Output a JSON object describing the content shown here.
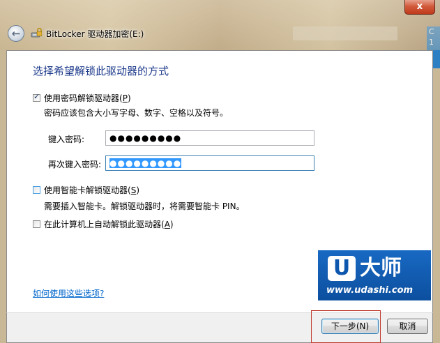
{
  "window": {
    "title": "BitLocker 驱动器加密(E:)",
    "close_label": "x",
    "side_glyphs": [
      "C",
      "1"
    ]
  },
  "page": {
    "heading": "选择希望解锁此驱动器的方式"
  },
  "options": {
    "password": {
      "label_pre": "使用密码解锁驱动器(",
      "accel": "P",
      "label_post": ")",
      "checked": true,
      "note": "密码应该包含大小写字母、数字、空格以及符号。",
      "enter_label": "键入密码:",
      "enter_value": "●●●●●●●●●",
      "reenter_label": "再次键入密码:",
      "reenter_value": "●●●●●●●●●"
    },
    "smartcard": {
      "label_pre": "使用智能卡解锁驱动器(",
      "accel": "S",
      "label_post": ")",
      "checked": false,
      "note": "需要插入智能卡。解锁驱动器时，将需要智能卡 PIN。"
    },
    "auto_unlock": {
      "label_pre": "在此计算机上自动解锁此驱动器(",
      "accel": "A",
      "label_post": ")",
      "checked": false
    }
  },
  "help_link": "如何使用这些选项?",
  "watermark": {
    "mark": "U",
    "name": "大师",
    "url": "www.udashi.com"
  },
  "buttons": {
    "next": "下一步(N)",
    "cancel": "取消"
  },
  "colors": {
    "heading": "#1e3b8c",
    "link": "#0066cc",
    "highlight": "#c0392b",
    "selection": "#3399ff"
  }
}
